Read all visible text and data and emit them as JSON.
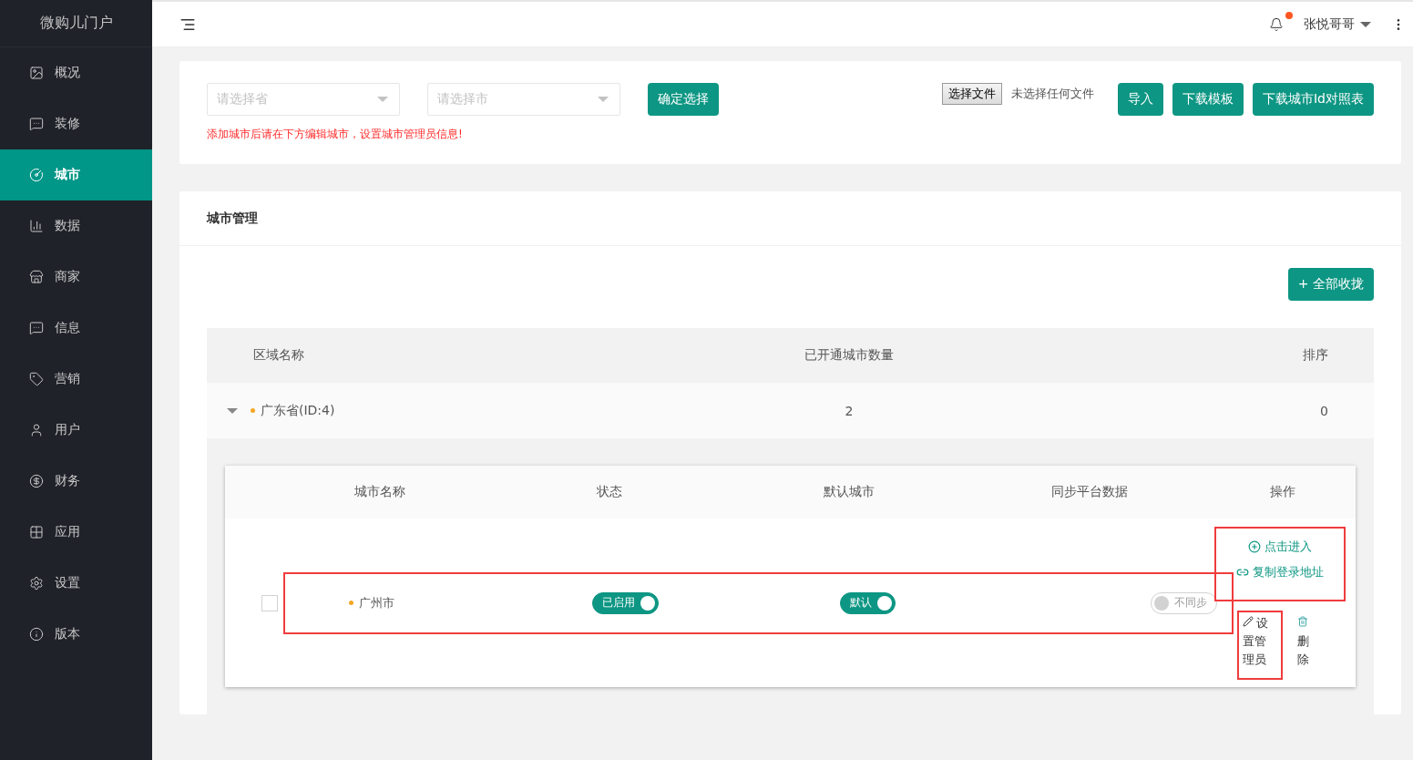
{
  "sidebar": {
    "title": "微购儿门户",
    "items": [
      {
        "label": "概况",
        "selected": false
      },
      {
        "label": "装修",
        "selected": false
      },
      {
        "label": "城市",
        "selected": true
      },
      {
        "label": "数据",
        "selected": false
      },
      {
        "label": "商家",
        "selected": false
      },
      {
        "label": "信息",
        "selected": false
      },
      {
        "label": "营销",
        "selected": false
      },
      {
        "label": "用户",
        "selected": false
      },
      {
        "label": "财务",
        "selected": false
      },
      {
        "label": "应用",
        "selected": false
      },
      {
        "label": "设置",
        "selected": false
      },
      {
        "label": "版本",
        "selected": false
      }
    ]
  },
  "header": {
    "user": "张悦哥哥",
    "unread": true
  },
  "import_card": {
    "province_select": {
      "placeholder": "请选择省"
    },
    "city_select": {
      "placeholder": "请选择市"
    },
    "confirm_button": "确定选择",
    "hint": "添加城市后请在下方编辑城市，设置城市管理员信息!",
    "file_button": "选择文件",
    "file_status": "未选择任何文件",
    "buttons": [
      "导入",
      "下载模板",
      "下载城市Id对照表"
    ]
  },
  "city_card": {
    "title": "城市管理",
    "collapse_button": "+ 全部收拢",
    "columns": [
      "区域名称",
      "已开通城市数量",
      "排序"
    ],
    "regions": [
      {
        "name": "广东省(ID:4)",
        "count": "2",
        "order": "0",
        "expanded": true,
        "city_table": {
          "columns": [
            "城市名称",
            "状态",
            "默认城市",
            "同步平台数据",
            "操作"
          ],
          "rows": [
            {
              "checked": false,
              "highlighted": true,
              "name": "广州市",
              "status": {
                "label": "已启用",
                "on": true
              },
              "default": {
                "label": "默认",
                "on": true
              },
              "sync": {
                "label": "不同步",
                "on": false
              },
              "links": {
                "highlighted": true,
                "items": [
                  "点击进入",
                  "复制登录地址"
                ]
              },
              "buttons": [
                {
                  "label": "设置管理员",
                  "highlighted": true
                },
                {
                  "label": "删除",
                  "highlighted": false
                }
              ]
            }
          ]
        }
      }
    ]
  }
}
